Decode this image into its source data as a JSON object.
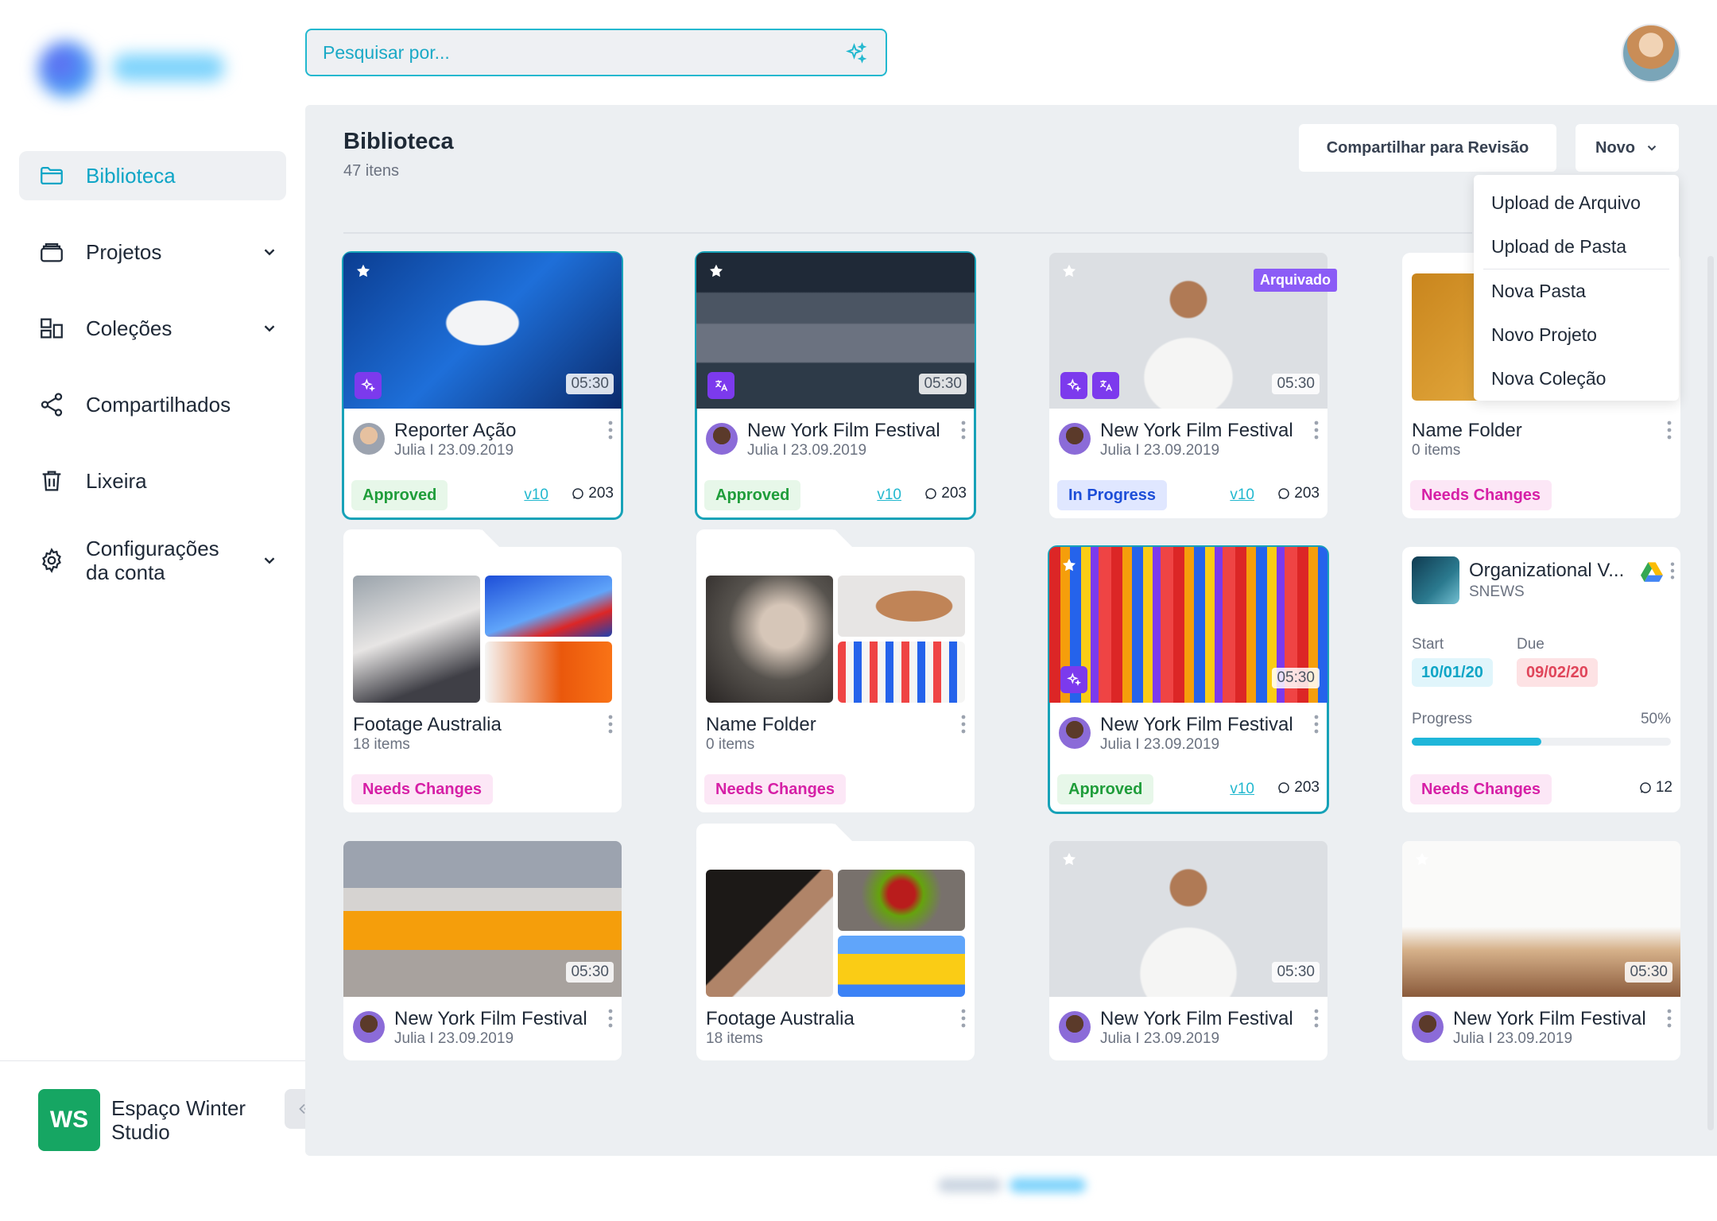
{
  "search": {
    "placeholder": "Pesquisar por..."
  },
  "sidebar": {
    "items": [
      {
        "label": "Biblioteca",
        "icon": "folder-icon",
        "active": true
      },
      {
        "label": "Projetos",
        "icon": "box-icon",
        "expandable": true
      },
      {
        "label": "Coleções",
        "icon": "collections-icon",
        "expandable": true
      },
      {
        "label": "Compartilhados",
        "icon": "share-icon"
      },
      {
        "label": "Lixeira",
        "icon": "trash-icon"
      },
      {
        "label": "Configurações da conta",
        "icon": "gear-icon",
        "expandable": true
      }
    ],
    "workspace": {
      "initials": "WS",
      "name": "Espaço Winter Studio",
      "color": "#16a663"
    }
  },
  "header": {
    "title": "Biblioteca",
    "count": "47 itens",
    "share_label": "Compartilhar para Revisão",
    "new_label": "Novo"
  },
  "new_menu": {
    "items": [
      "Upload de Arquivo",
      "Upload de Pasta",
      "Nova Pasta",
      "Novo Projeto",
      "Nova Coleção"
    ]
  },
  "cards": [
    {
      "title": "Reporter Ação",
      "sub": "Julia I 23.09.2019",
      "duration": "05:30",
      "status": "Approved",
      "version": "v10",
      "comments": "203"
    },
    {
      "title": "New York Film Festival",
      "sub": "Julia I 23.09.2019",
      "duration": "05:30",
      "status": "Approved",
      "version": "v10",
      "comments": "203"
    },
    {
      "title": "New York Film Festival",
      "sub": "Julia I 23.09.2019",
      "duration": "05:30",
      "status": "In Progress",
      "version": "v10",
      "comments": "203",
      "ribbon": "Arquivado"
    },
    {
      "title": "Name Folder",
      "sub": "0 items",
      "status": "Needs Changes"
    },
    {
      "title": "Footage Australia",
      "sub": "18 items",
      "status": "Needs Changes"
    },
    {
      "title": "Name Folder",
      "sub": "0 items",
      "status": "Needs Changes"
    },
    {
      "title": "New York Film Festival",
      "sub": "Julia I 23.09.2019",
      "duration": "05:30",
      "status": "Approved",
      "version": "v10",
      "comments": "203"
    },
    {
      "title": "Organizational V...",
      "sub": "SNEWS",
      "start_label": "Start",
      "start": "10/01/20",
      "due_label": "Due",
      "due": "09/02/20",
      "progress_label": "Progress",
      "progress": "50%",
      "progress_value": 0.5,
      "status": "Needs Changes",
      "comments": "12"
    },
    {
      "title": "New York Film Festival",
      "sub": "Julia I 23.09.2019",
      "duration": "05:30"
    },
    {
      "title": "Footage Australia",
      "sub": "18 items"
    },
    {
      "title": "New York Film Festival",
      "sub": "Julia I 23.09.2019",
      "duration": "05:30"
    },
    {
      "title": "New York Film Festival",
      "sub": "Julia I 23.09.2019",
      "duration": "05:30"
    }
  ],
  "colors": {
    "accent": "#22b8cf",
    "approved": "#1f9d3a",
    "in_progress": "#1d4ed8",
    "needs_changes": "#d61fa6",
    "badge_purple": "#7c3aed"
  }
}
